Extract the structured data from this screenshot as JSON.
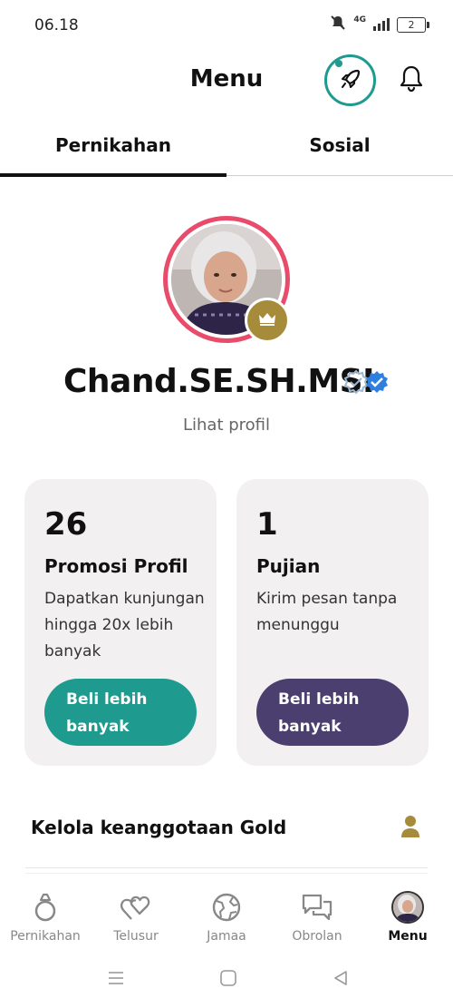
{
  "status_bar": {
    "time": "06.18",
    "network": "4G",
    "battery": "2"
  },
  "header": {
    "title": "Menu",
    "icons": [
      "rocket-icon",
      "bell-icon"
    ]
  },
  "tabs": [
    {
      "label": "Pernikahan",
      "active": true
    },
    {
      "label": "Sosial",
      "active": false
    }
  ],
  "profile": {
    "name": "Chand.SE.SH.MSI",
    "view_link": "Lihat profil",
    "badges": [
      "crown-icon",
      "verified-icon"
    ]
  },
  "cards": [
    {
      "count": "26",
      "title": "Promosi Profil",
      "description": "Dapatkan kunjungan hingga 20x lebih banyak",
      "button": "Beli lebih banyak",
      "color": "#1f9a8f"
    },
    {
      "count": "1",
      "title": "Pujian",
      "description": "Kirim pesan tanpa menunggu",
      "button": "Beli lebih banyak",
      "color": "#4a3f6e"
    }
  ],
  "gold": {
    "label": "Kelola keanggotaan Gold",
    "icon": "person-icon"
  },
  "bottom_nav": [
    {
      "label": "Pernikahan",
      "icon": "ring-icon",
      "active": false
    },
    {
      "label": "Telusur",
      "icon": "hearts-icon",
      "active": false
    },
    {
      "label": "Jamaa",
      "icon": "globe-icon",
      "active": false
    },
    {
      "label": "Obrolan",
      "icon": "chat-icon",
      "active": false
    },
    {
      "label": "Menu",
      "icon": "avatar",
      "active": true
    }
  ],
  "colors": {
    "teal": "#1f9a8f",
    "purple": "#4a3f6e",
    "gold": "#a68b3a",
    "avatar_ring": "#e94c6b",
    "verified_blue": "#2f7fe0"
  }
}
